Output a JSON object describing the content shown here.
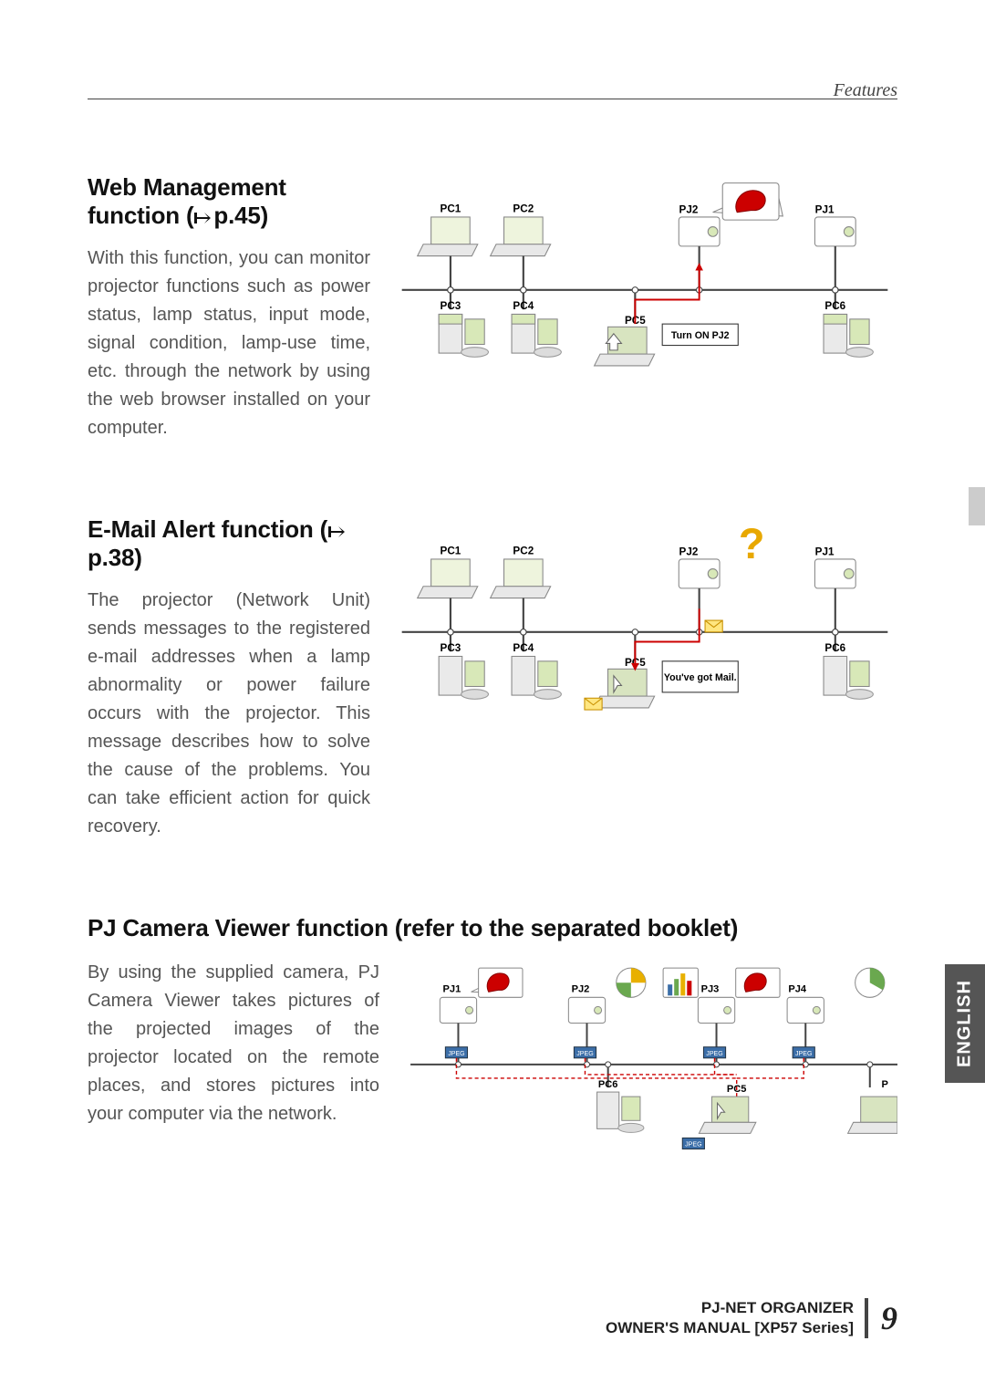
{
  "header": {
    "label": "Features"
  },
  "sections": {
    "web": {
      "title_pre": "Web Management function (",
      "title_pref": "p.45)",
      "body": "With this function, you can monitor projector functions such as power status, lamp status, input mode, signal condition, lamp-use time, etc. through the network by using the web browser installed on your computer."
    },
    "email": {
      "title_pre": "E-Mail Alert function (",
      "title_pref": "p.38)",
      "body": "The projector (Network Unit) sends messages to the registered e-mail addresses when a lamp abnormality or power failure occurs with the projector. This message describes how to solve the cause of the problems. You can take efficient action for quick recovery."
    },
    "camera": {
      "title": "PJ Camera Viewer function (refer to the separated booklet)",
      "body": "By using the supplied camera, PJ Camera Viewer takes pictures of the projected images of the projector located on the remote places, and stores pictures into your computer via the network."
    }
  },
  "diagram_labels": {
    "d1": {
      "pc1": "PC1",
      "pc2": "PC2",
      "pc3": "PC3",
      "pc4": "PC4",
      "pc5": "PC5",
      "pc6": "PC6",
      "pj1": "PJ1",
      "pj2": "PJ2",
      "callout": "Turn ON  PJ2"
    },
    "d2": {
      "pc1": "PC1",
      "pc2": "PC2",
      "pc3": "PC3",
      "pc4": "PC4",
      "pc5": "PC5",
      "pc6": "PC6",
      "pj1": "PJ1",
      "pj2": "PJ2",
      "callout": "You've got Mail."
    },
    "d3": {
      "pj1": "PJ1",
      "pj2": "PJ2",
      "pj3": "PJ3",
      "pj4": "PJ4",
      "pc5": "PC5",
      "pc6": "PC6",
      "p": "P",
      "jpeg": "JPEG"
    }
  },
  "sidebar_tab": "ENGLISH",
  "footer": {
    "line1": "PJ-NET ORGANIZER",
    "line2": "OWNER'S MANUAL [XP57 Series]",
    "page": "9"
  }
}
